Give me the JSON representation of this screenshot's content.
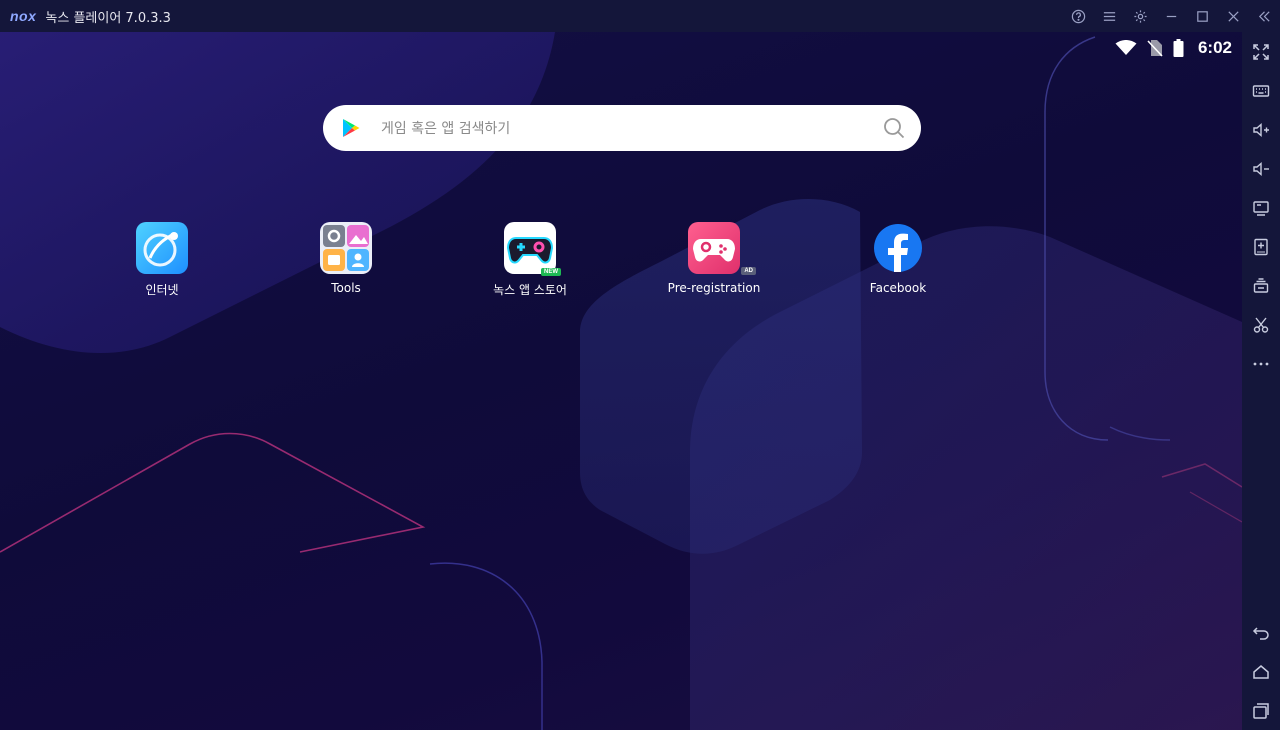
{
  "window": {
    "logo": "nox",
    "title": "녹스 플레이어 7.0.3.3"
  },
  "title_controls": [
    {
      "name": "help-icon"
    },
    {
      "name": "menu-icon"
    },
    {
      "name": "settings-icon"
    },
    {
      "name": "minimize-icon"
    },
    {
      "name": "maximize-icon"
    },
    {
      "name": "close-icon"
    },
    {
      "name": "collapse-sidebar-icon"
    }
  ],
  "status_bar": {
    "time": "6:02",
    "icons": [
      "wifi-icon",
      "no-sim-icon",
      "battery-icon"
    ]
  },
  "search": {
    "placeholder": "게임 혹은 앱 검색하기"
  },
  "apps": [
    {
      "label": "인터넷",
      "icon": "internet-icon",
      "badge": ""
    },
    {
      "label": "Tools",
      "icon": "tools-folder-icon",
      "badge": ""
    },
    {
      "label": "녹스 앱 스토어",
      "icon": "nox-app-store-icon",
      "badge": "NEW"
    },
    {
      "label": "Pre-registration",
      "icon": "pre-registration-icon",
      "badge": "AD"
    },
    {
      "label": "Facebook",
      "icon": "facebook-icon",
      "badge": ""
    }
  ],
  "sidebar": [
    "fullscreen-icon",
    "keyboard-icon",
    "volume-up-icon",
    "volume-down-icon",
    "screen-icon",
    "apk-install-icon",
    "multi-instance-icon",
    "screenshot-icon",
    "more-icon"
  ],
  "sidebar_bottom": [
    "back-icon",
    "home-icon",
    "recent-apps-icon"
  ],
  "colors": {
    "titlebar": "#14163a",
    "facebook": "#1877f2",
    "new_badge": "#1db954"
  }
}
